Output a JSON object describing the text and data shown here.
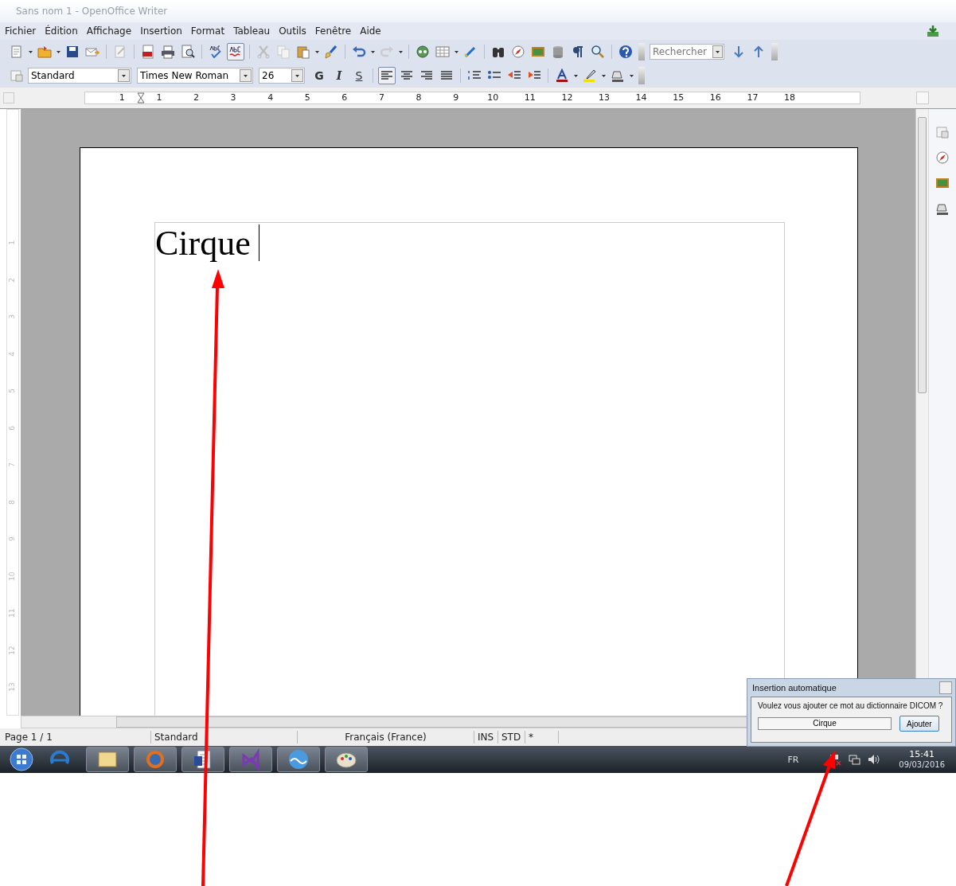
{
  "window": {
    "title": "Sans nom 1 - OpenOffice Writer"
  },
  "menu": [
    "Fichier",
    "Édition",
    "Affichage",
    "Insertion",
    "Format",
    "Tableau",
    "Outils",
    "Fenêtre",
    "Aide"
  ],
  "standard_toolbar": {
    "autospellcheck_on": true,
    "search": {
      "placeholder": "Rechercher"
    }
  },
  "formatting_toolbar": {
    "paragraph_style": "Standard",
    "font_name": "Times New Roman",
    "font_size": "26",
    "format_buttons": [
      {
        "label": "G"
      },
      {
        "label": "I"
      },
      {
        "label": "S"
      }
    ],
    "align_buttons": [
      {
        "selected": true
      },
      {
        "selected": false
      },
      {
        "selected": false
      },
      {
        "selected": false
      }
    ]
  },
  "horizontal_ruler": [
    "1",
    "1",
    "2",
    "3",
    "4",
    "5",
    "6",
    "7",
    "8",
    "9",
    "10",
    "11",
    "12",
    "13",
    "14",
    "15",
    "16",
    "17",
    "18"
  ],
  "vertical_ruler": [
    "1",
    "2",
    "3",
    "4",
    "5",
    "6",
    "7",
    "8",
    "9",
    "10",
    "11",
    "12",
    "13"
  ],
  "document": {
    "text": "Cirque"
  },
  "status_bar": [
    "Page 1 / 1",
    "Standard",
    "Français (France)",
    "INS",
    "STD",
    "*"
  ],
  "dialog": {
    "title": "Insertion automatique",
    "message": "Voulez vous ajouter ce mot au dictionnaire DICOM ?",
    "value": "Cirque",
    "button": "Ajouter"
  },
  "tray": {
    "language": "FR",
    "time": "15:41",
    "date": "09/03/2016"
  }
}
